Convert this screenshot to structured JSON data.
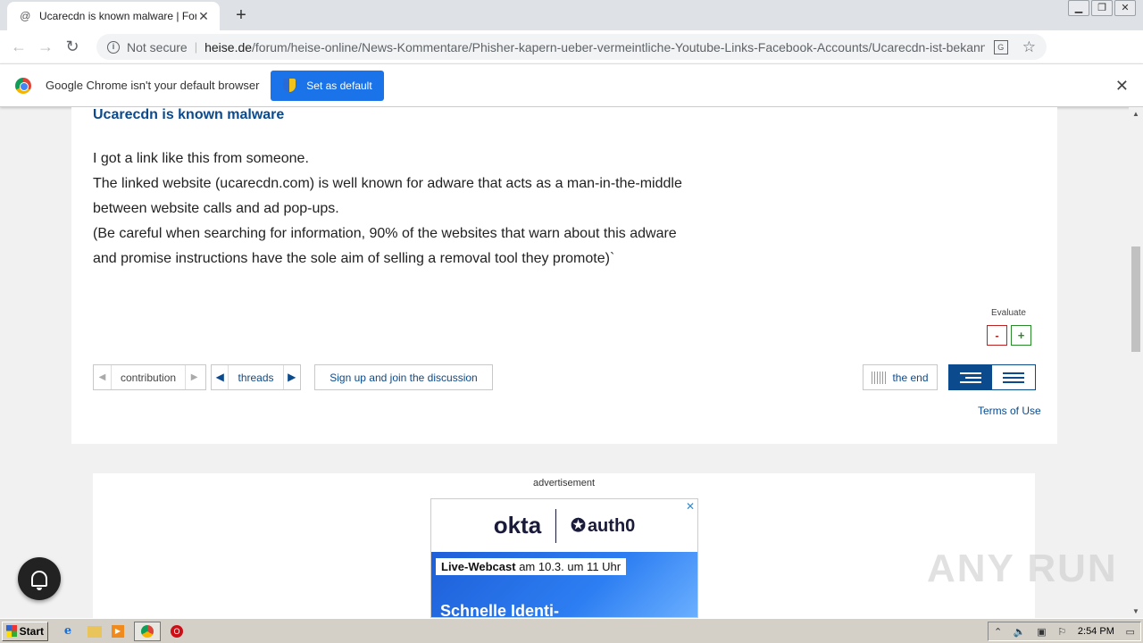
{
  "browser": {
    "tab_title": "Ucarecdn is known malware | Forum",
    "tab_favicon": "@",
    "tab_close": "✕",
    "new_tab": "+",
    "security_label": "Not secure",
    "url_host": "heise.de",
    "url_path": "/forum/heise-online/News-Kommentare/Phisher-kapern-ueber-vermeintliche-Youtube-Links-Facebook-Accounts/Ucarecdn-ist-bekannte-Mal...",
    "icons": [
      "back-arrow-icon",
      "forward-arrow-icon",
      "reload-icon",
      "info-icon",
      "translate-icon",
      "star-icon",
      "profile-icon",
      "menu-icon"
    ]
  },
  "infobar": {
    "message": "Google Chrome isn't your default browser",
    "button_label": "Set as default",
    "close": "✕"
  },
  "post": {
    "title": "Ucarecdn is known malware",
    "lines": [
      "I got a link like this from someone.",
      "The linked website (ucarecdn.com) is well known for adware that acts as a man-in-the-middle",
      "between website calls and ad pop-ups.",
      "(Be careful when searching for information, 90% of the websites that warn about this adware",
      "and promise instructions have the sole aim of selling a removal tool they promote)`"
    ],
    "evaluate_label": "Evaluate",
    "vote_minus": "-",
    "vote_plus": "+"
  },
  "forum_nav": {
    "contribution_label": "contribution",
    "threads_label": "threads",
    "signup_label": "Sign up and join the discussion",
    "end_label": "the end",
    "terms_label": "Terms of Use"
  },
  "ad": {
    "label": "advertisement",
    "brand1": "okta",
    "brand2": "auth0",
    "brand2_star": "✪",
    "close": "✕",
    "webcast_bold": "Live-Webcast",
    "webcast_rest": " am 10.3. um 11 Uhr",
    "headline": "Schnelle Identi-"
  },
  "watermark": "ANY RUN",
  "taskbar": {
    "start_label": "Start",
    "clock": "2:54 PM"
  },
  "colors": {
    "heise_blue": "#0b4a8c",
    "chrome_blue": "#1a73e8",
    "minus_red": "#bb2222",
    "plus_green": "#2a8a2a"
  }
}
